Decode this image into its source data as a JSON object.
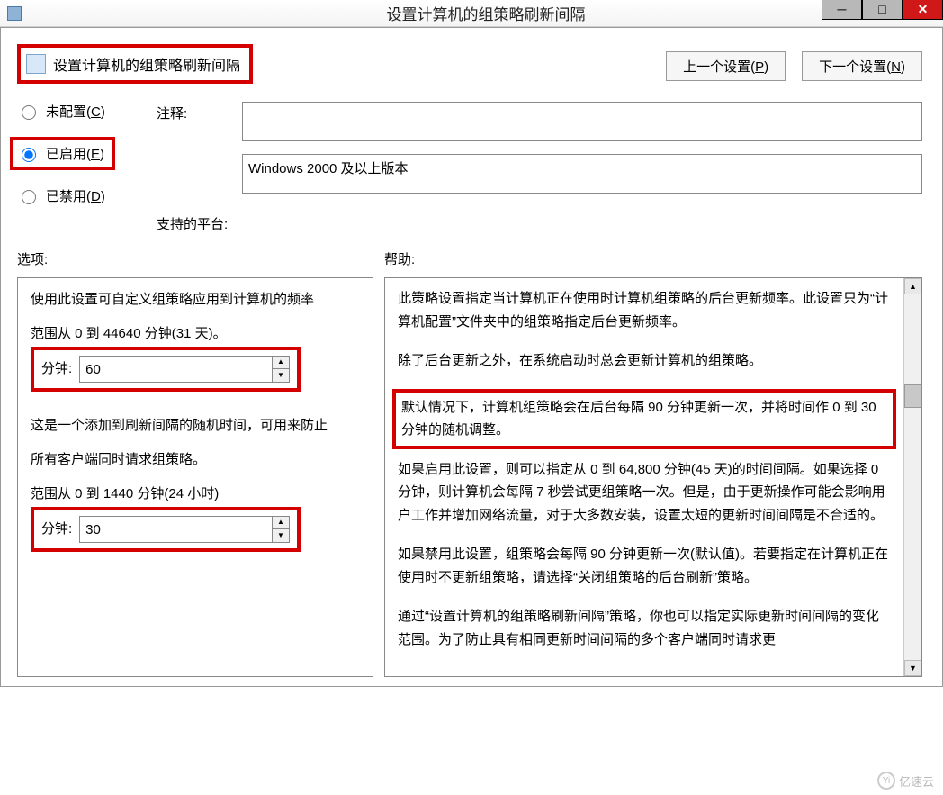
{
  "window": {
    "title": "设置计算机的组策略刷新间隔",
    "min_tip": "−",
    "max_tip": "□",
    "close_tip": "✕"
  },
  "policy": {
    "icon_name": "policy-editor-icon",
    "title": "设置计算机的组策略刷新间隔"
  },
  "nav": {
    "prev": "上一个设置(",
    "prev_u": "P",
    "prev_end": ")",
    "next": "下一个设置(",
    "next_u": "N",
    "next_end": ")"
  },
  "radios": {
    "not_configured_pre": "未配置(",
    "not_configured_u": "C",
    "not_configured_end": ")",
    "enabled_pre": "已启用(",
    "enabled_u": "E",
    "enabled_end": ")",
    "disabled_pre": "已禁用(",
    "disabled_u": "D",
    "disabled_end": ")"
  },
  "labels": {
    "comment": "注释:",
    "supported": "支持的平台:",
    "options": "选项:",
    "help": "帮助:"
  },
  "comment_value": "",
  "supported_value": "Windows 2000 及以上版本",
  "options": {
    "intro": "使用此设置可自定义组策略应用到计算机的频率",
    "range1": "范围从 0 到 44640 分钟(31 天)。",
    "minutes_label": "分钟:",
    "interval_value": "60",
    "random_intro": "这是一个添加到刷新间隔的随机时间，可用来防止",
    "random_line2": "所有客户端同时请求组策略。",
    "range2": "范围从 0 到 1440 分钟(24 小时)",
    "offset_value": "30"
  },
  "help": {
    "p1": "此策略设置指定当计算机正在使用时计算机组策略的后台更新频率。此设置只为“计算机配置”文件夹中的组策略指定后台更新频率。",
    "p2": "除了后台更新之外，在系统启动时总会更新计算机的组策略。",
    "highlight": "默认情况下，计算机组策略会在后台每隔 90 分钟更新一次，并将时间作 0 到 30 分钟的随机调整。",
    "p3": "如果启用此设置，则可以指定从 0 到 64,800 分钟(45 天)的时间间隔。如果选择 0 分钟，则计算机会每隔 7 秒尝试更组策略一次。但是，由于更新操作可能会影响用户工作并增加网络流量，对于大多数安装，设置太短的更新时间间隔是不合适的。",
    "p4": "如果禁用此设置，组策略会每隔 90 分钟更新一次(默认值)。若要指定在计算机正在使用时不更新组策略，请选择“关闭组策略的后台刷新”策略。",
    "p5": "通过“设置计算机的组策略刷新间隔”策略，你也可以指定实际更新时间间隔的变化范围。为了防止具有相同更新时间间隔的多个客户端同时请求更"
  },
  "watermark": "亿速云"
}
